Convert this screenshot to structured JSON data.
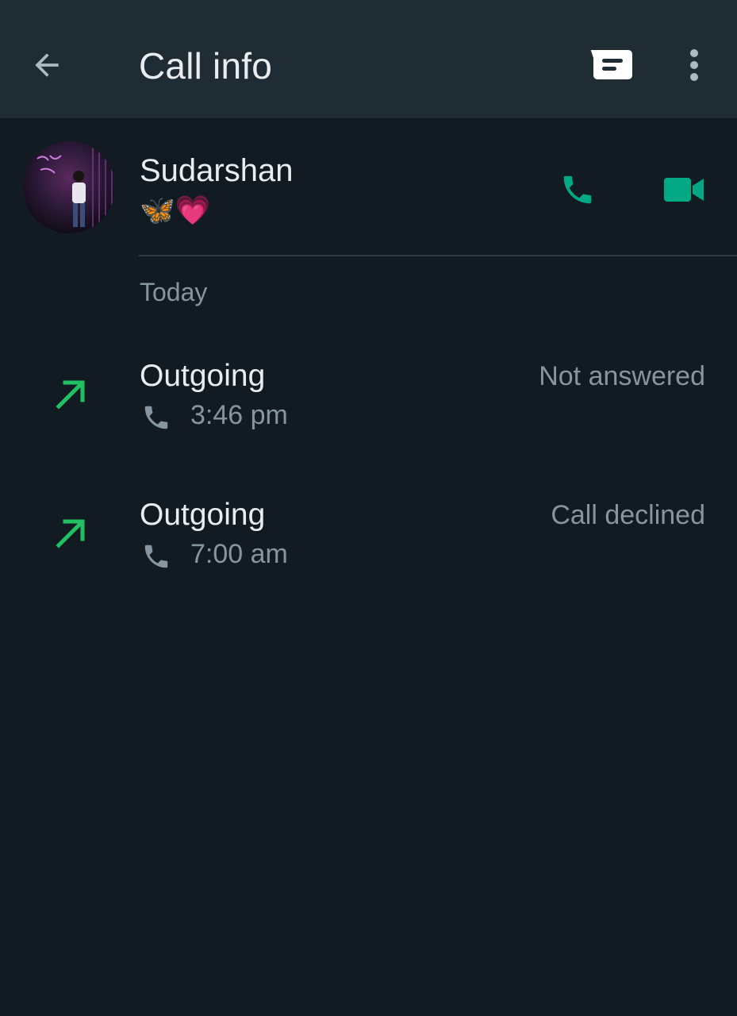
{
  "header": {
    "title": "Call info",
    "back_icon": "arrow-left-icon",
    "message_icon": "message-icon",
    "more_icon": "more-vert-icon"
  },
  "contact": {
    "name": "Sudarshan",
    "status": "🦋💗",
    "voice_call_icon": "phone-icon",
    "video_call_icon": "videocam-icon"
  },
  "history": {
    "section_label": "Today",
    "calls": [
      {
        "type": "Outgoing",
        "time": "3:46 pm",
        "status": "Not answered",
        "direction_icon": "arrow-outgoing-icon"
      },
      {
        "type": "Outgoing",
        "time": "7:00 am",
        "status": "Call declined",
        "direction_icon": "arrow-outgoing-icon"
      }
    ]
  },
  "colors": {
    "background": "#121b22",
    "appbar": "#202c33",
    "accent_green": "#00a884",
    "outgoing_arrow": "#21c063",
    "secondary_text": "#8696a0"
  }
}
